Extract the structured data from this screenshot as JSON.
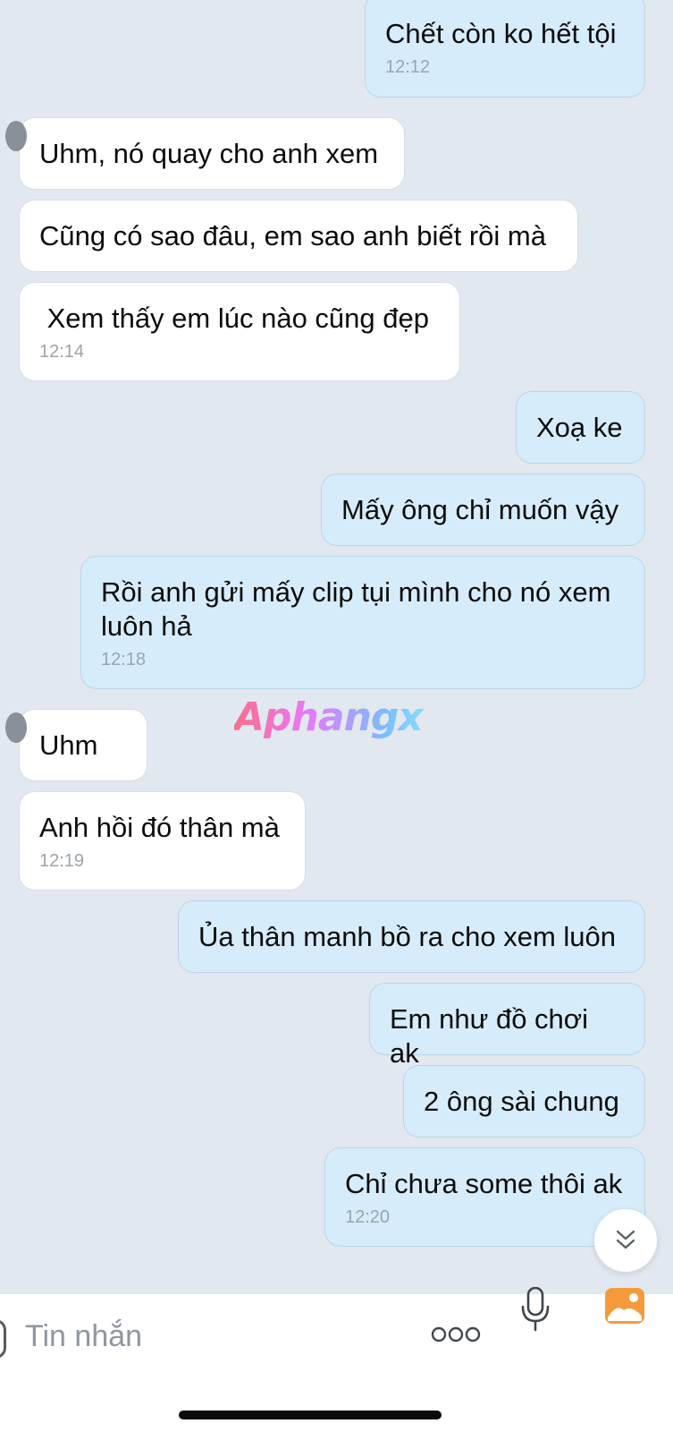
{
  "messages": [
    {
      "side": "sent",
      "text": "Chết còn ko hết tội",
      "time": "12:12"
    },
    {
      "side": "received",
      "text": "Uhm, nó quay cho anh xem",
      "time": ""
    },
    {
      "side": "received",
      "text": "Cũng có sao đâu, em sao anh biết rồi mà",
      "time": ""
    },
    {
      "side": "received",
      "text": " Xem thấy em lúc nào cũng đẹp",
      "time": "12:14"
    },
    {
      "side": "sent",
      "text": "Xoạ ke",
      "time": ""
    },
    {
      "side": "sent",
      "text": "Mấy ông chỉ muốn vậy",
      "time": ""
    },
    {
      "side": "sent",
      "text": "Rồi anh gửi mấy clip tụi mình cho nó xem luôn hả",
      "time": "12:18"
    },
    {
      "side": "received",
      "text": "Uhm",
      "time": ""
    },
    {
      "side": "received",
      "text": "Anh hồi đó thân mà",
      "time": "12:19"
    },
    {
      "side": "sent",
      "text": "Ủa thân manh bồ ra cho xem luôn",
      "time": ""
    },
    {
      "side": "sent",
      "text": "Em như đồ chơi ak",
      "time": ""
    },
    {
      "side": "sent",
      "text": "2 ông sài chung",
      "time": ""
    },
    {
      "side": "sent",
      "text": "Chỉ chưa some thôi ak",
      "time": "12:20"
    }
  ],
  "watermark": "Aphangx",
  "composer": {
    "placeholder": "Tin nhắn",
    "icons": [
      "more-icon",
      "microphone-icon",
      "image-icon"
    ]
  },
  "colors": {
    "background": "#e2e8ef",
    "sent_bubble": "#d6ecfb",
    "received_bubble": "#ffffff",
    "image_icon_orange": "#f59a3a"
  }
}
